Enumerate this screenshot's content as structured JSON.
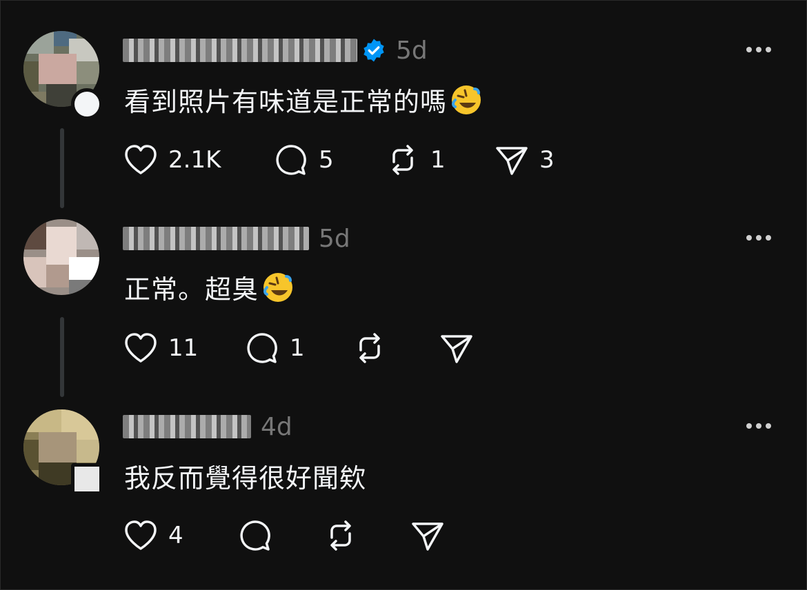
{
  "colors": {
    "background": "#101010",
    "text": "#f3f5f7",
    "muted": "#777777",
    "verified": "#0095f6",
    "thread_line": "#333638"
  },
  "posts": [
    {
      "username": "",
      "verified": true,
      "time": "5d",
      "text": "看到照片有味道是正常的嗎",
      "emoji": "rolling-on-floor-laughing",
      "likes": "2.1K",
      "replies": "5",
      "reposts": "1",
      "shares": "3"
    },
    {
      "username": "",
      "verified": false,
      "time": "5d",
      "text": "正常。超臭",
      "emoji": "rolling-on-floor-laughing",
      "likes": "11",
      "replies": "1",
      "reposts": "",
      "shares": ""
    },
    {
      "username": "",
      "verified": false,
      "time": "4d",
      "text": "我反而覺得很好聞欸",
      "emoji": "",
      "likes": "4",
      "replies": "",
      "reposts": "",
      "shares": ""
    }
  ]
}
